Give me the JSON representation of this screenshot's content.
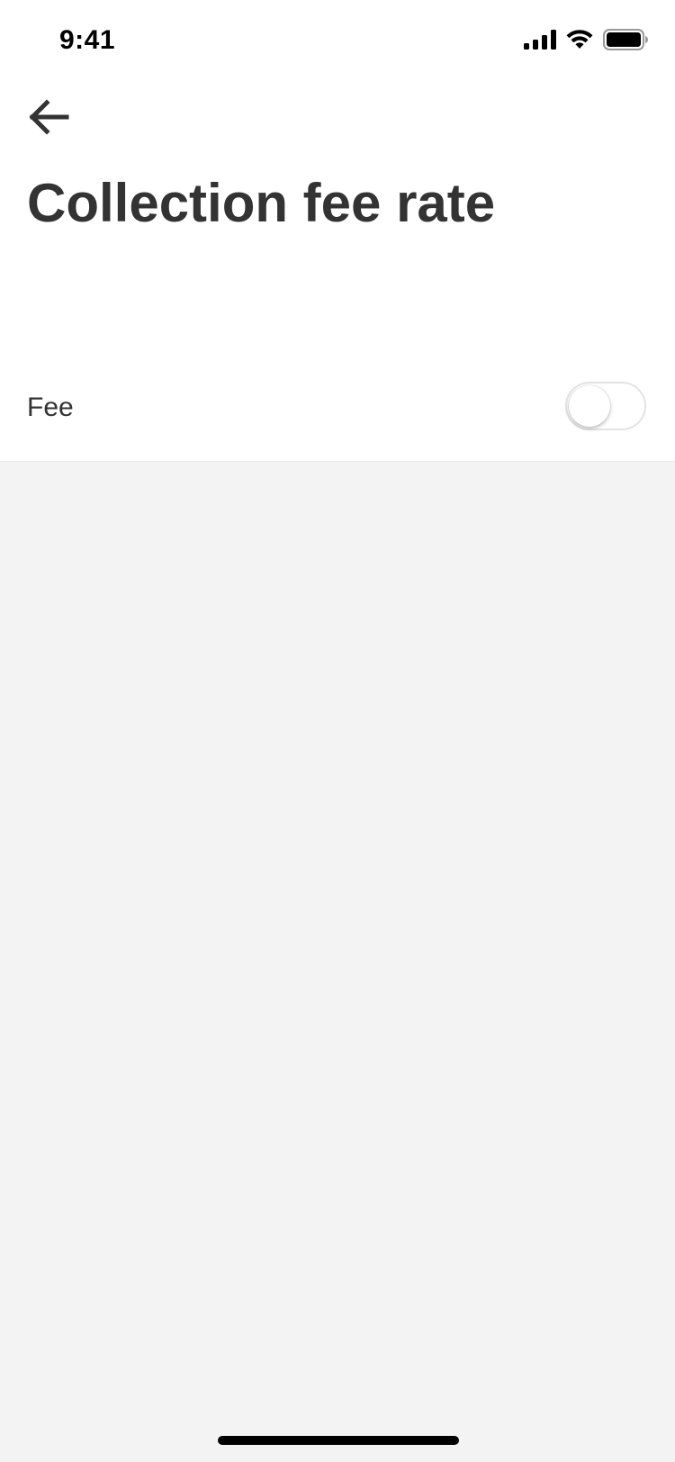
{
  "status_bar": {
    "time": "9:41"
  },
  "header": {
    "back_icon": "arrow-left-icon",
    "title": "Collection fee rate"
  },
  "settings": {
    "fee_label": "Fee",
    "fee_enabled": false
  },
  "colors": {
    "text": "#333333",
    "background": "#f3f3f3",
    "surface": "#ffffff",
    "toggle_border": "#e3e3e3"
  }
}
